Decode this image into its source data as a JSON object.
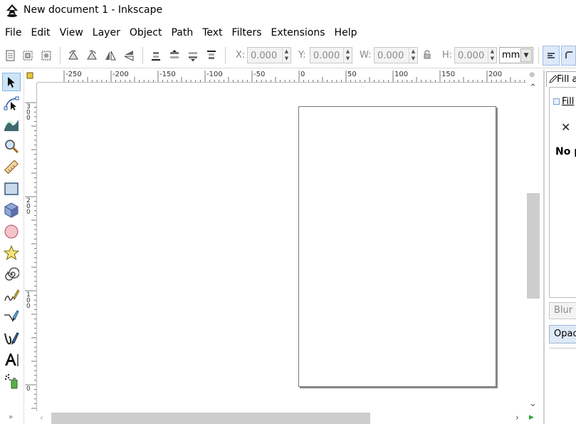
{
  "window": {
    "title": "New document 1 - Inkscape"
  },
  "menubar": {
    "items": [
      "File",
      "Edit",
      "View",
      "Layer",
      "Object",
      "Path",
      "Text",
      "Filters",
      "Extensions",
      "Help"
    ]
  },
  "controls": {
    "x_label": "X:",
    "x_value": "0.000",
    "y_label": "Y:",
    "y_value": "0.000",
    "w_label": "W:",
    "w_value": "0.000",
    "h_label": "H:",
    "h_value": "0.000",
    "unit": "mm"
  },
  "toolbox": {
    "tools": [
      "selector-tool",
      "node-tool",
      "tweak-tool",
      "zoom-tool",
      "measure-tool",
      "rectangle-tool",
      "box-3d-tool",
      "ellipse-tool",
      "star-tool",
      "spiral-tool",
      "pencil-tool",
      "pen-tool",
      "calligraphy-tool",
      "text-tool",
      "spray-tool"
    ],
    "active_tool": "selector-tool",
    "expander": "»"
  },
  "rulers": {
    "horizontal_labels": [
      "-250",
      "-200",
      "-150",
      "-100",
      "-50",
      "0",
      "50",
      "100",
      "150",
      "200"
    ],
    "vertical_labels": [
      "300",
      "200",
      "100",
      "0"
    ]
  },
  "dock": {
    "tab_label": "Fill and Stroke",
    "fill_tab": "Fill",
    "paint_state": "No paint",
    "paint_state_icon": "✕",
    "blur_label": "Blur (%)",
    "opacity_label": "Opacity (%)"
  },
  "colors": {
    "active_tool_bg": "#cde4f7",
    "scroll_thumb": "#cdcdcd",
    "page_border": "#777777"
  }
}
